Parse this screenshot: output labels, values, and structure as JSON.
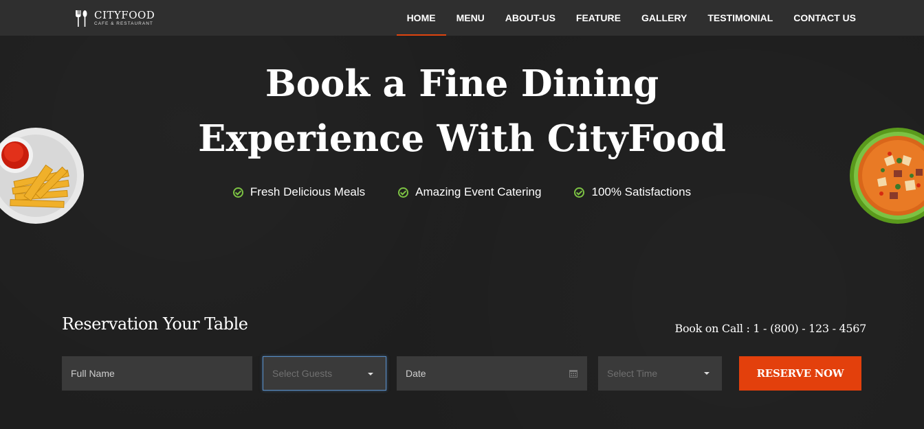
{
  "logo": {
    "name": "CITYFOOD",
    "tagline": "CAFE & RESTAURANT",
    "icon": "fork-spoon-icon"
  },
  "nav": {
    "items": [
      {
        "label": "HOME",
        "active": true
      },
      {
        "label": "MENU"
      },
      {
        "label": "ABOUT-US"
      },
      {
        "label": "FEATURE"
      },
      {
        "label": "GALLERY"
      },
      {
        "label": "TESTIMONIAL"
      },
      {
        "label": "CONTACT US"
      }
    ]
  },
  "hero": {
    "title_line1": "Book a Fine Dining",
    "title_line2": "Experience With CityFood",
    "features": [
      {
        "label": "Fresh Delicious Meals",
        "icon": "check-circle-icon"
      },
      {
        "label": "Amazing Event Catering",
        "icon": "check-circle-icon"
      },
      {
        "label": "100% Satisfactions",
        "icon": "check-circle-icon"
      }
    ]
  },
  "reservation": {
    "title": "Reservation Your Table",
    "call_text": "Book on Call : 1 - (800) - 123 - 4567",
    "full_name_placeholder": "Full Name",
    "guests_placeholder": "Select Guests",
    "date_placeholder": "Date",
    "time_placeholder": "Select Time",
    "button_label": "RESERVE NOW"
  },
  "colors": {
    "accent": "#e3400c",
    "check": "#7cc243",
    "nav_bg": "#2f2f2f",
    "field_bg": "#3a3a3a"
  }
}
